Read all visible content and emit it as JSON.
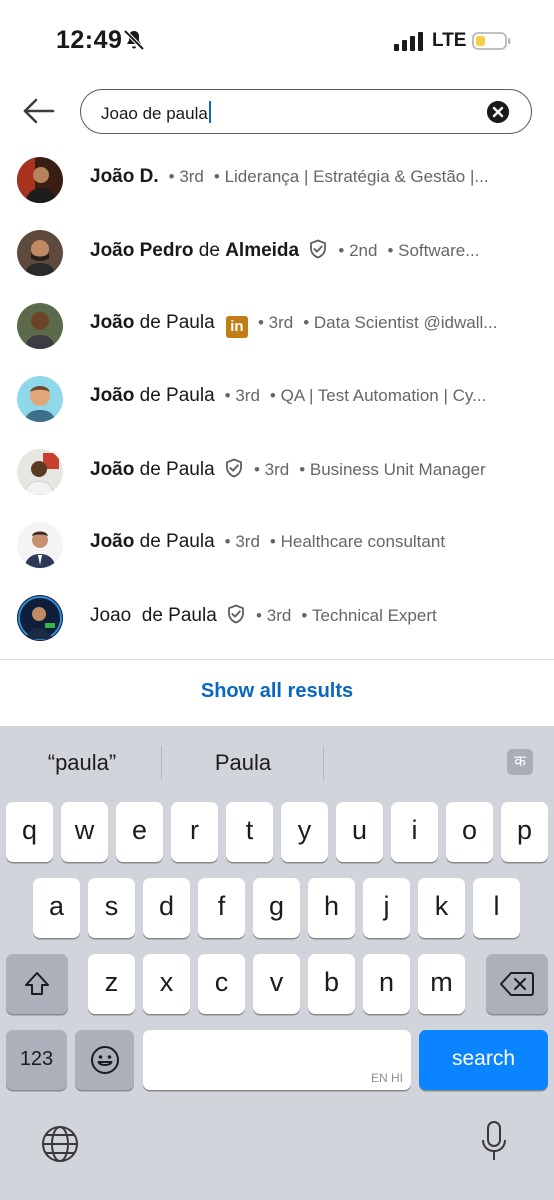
{
  "status": {
    "time": "12:49",
    "network": "LTE"
  },
  "search": {
    "query": "Joao de paula"
  },
  "results": [
    {
      "bold": "João D.",
      "reg": "",
      "degree": "3rd",
      "headline": "Liderança | Estratégia & Gestão |...",
      "badge": "none"
    },
    {
      "bold": "João Pedro",
      "reg": " de ",
      "bold2": "Almeida",
      "degree": "2nd",
      "headline": "Software...",
      "badge": "verified"
    },
    {
      "bold": "João",
      "reg": " de Paula",
      "degree": "3rd",
      "headline": "Data Scientist @idwall...",
      "badge": "linkedin"
    },
    {
      "bold": "João",
      "reg": " de Paula",
      "degree": "3rd",
      "headline": "QA | Test Automation | Cy...",
      "badge": "none"
    },
    {
      "bold": "João",
      "reg": " de Paula",
      "degree": "3rd",
      "headline": "Business Unit Manager",
      "badge": "verified"
    },
    {
      "bold": "João",
      "reg": " de Paula",
      "degree": "3rd",
      "headline": "Healthcare consultant",
      "badge": "none"
    },
    {
      "bold": "",
      "reg": "Joao  de Paula",
      "degree": "3rd",
      "headline": "Technical Expert",
      "badge": "verified"
    }
  ],
  "show_all": "Show all results",
  "keyboard": {
    "suggestions": [
      "“paula”",
      "Paula"
    ],
    "lang_key": "क",
    "row1": [
      "q",
      "w",
      "e",
      "r",
      "t",
      "y",
      "u",
      "i",
      "o",
      "p"
    ],
    "row2": [
      "a",
      "s",
      "d",
      "f",
      "g",
      "h",
      "j",
      "k",
      "l"
    ],
    "row3": [
      "z",
      "x",
      "c",
      "v",
      "b",
      "n",
      "m"
    ],
    "numbers_key": "123",
    "space_hint": "EN HI",
    "action_key": "search"
  },
  "colors": {
    "accent": "#0a66c2",
    "search_key": "#0a84ff",
    "linkedin_badge": "#c37d16"
  }
}
